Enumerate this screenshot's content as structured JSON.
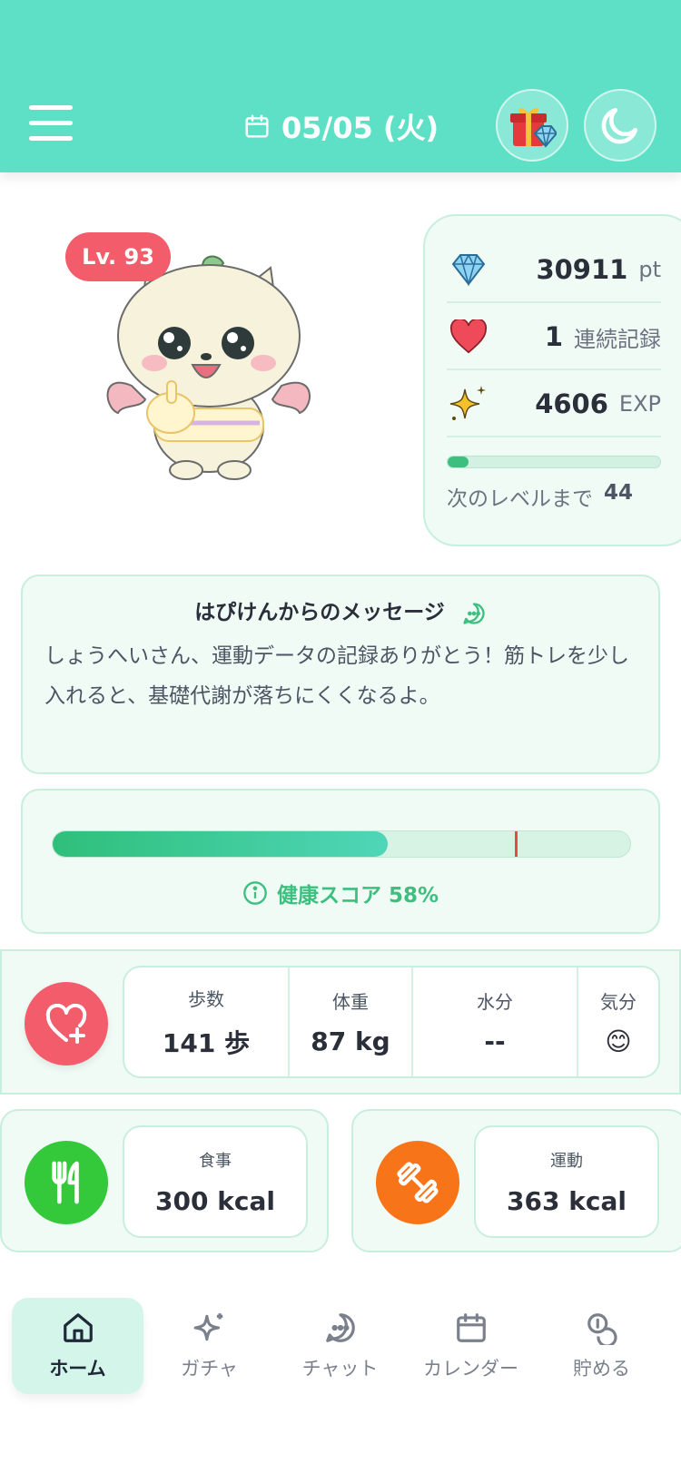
{
  "header": {
    "date": "05/05 (火)",
    "colors": {
      "bar": "#5ee0c6"
    }
  },
  "character": {
    "level": "Lv. 93"
  },
  "stats": {
    "points": {
      "value": "30911",
      "unit": "pt",
      "icon": "diamond-icon"
    },
    "streak": {
      "value": "1",
      "unit": "連続記録",
      "icon": "heart-icon"
    },
    "exp": {
      "value": "4606",
      "unit": "EXP",
      "icon": "sparkle-icon"
    },
    "exp_progress": 0.1,
    "next_level_label": "次のレベルまで",
    "next_level_value": "44"
  },
  "message": {
    "title": "はぴけんからのメッセージ",
    "body": "しょうへいさん、運動データの記録ありがとう！筋トレを少し入れると、基礎代謝が落ちにくくなるよ。"
  },
  "health_score": {
    "label": "健康スコア 58%",
    "progress": 0.58,
    "target": 0.8
  },
  "metrics": [
    {
      "label": "歩数",
      "value": "141 歩"
    },
    {
      "label": "体重",
      "value": "87 kg"
    },
    {
      "label": "水分",
      "value": "--"
    },
    {
      "label": "気分",
      "value": "😊"
    }
  ],
  "meal": {
    "label": "食事",
    "value": "300 kcal",
    "color": "#34c93a"
  },
  "exercise": {
    "label": "運動",
    "value": "363 kcal",
    "color": "#f77418"
  },
  "nav": [
    {
      "label": "ホーム",
      "icon": "home-icon",
      "active": true
    },
    {
      "label": "ガチャ",
      "icon": "sparkle-icon"
    },
    {
      "label": "チャット",
      "icon": "chat-icon"
    },
    {
      "label": "カレンダー",
      "icon": "calendar-icon"
    },
    {
      "label": "貯める",
      "icon": "coins-icon"
    }
  ]
}
